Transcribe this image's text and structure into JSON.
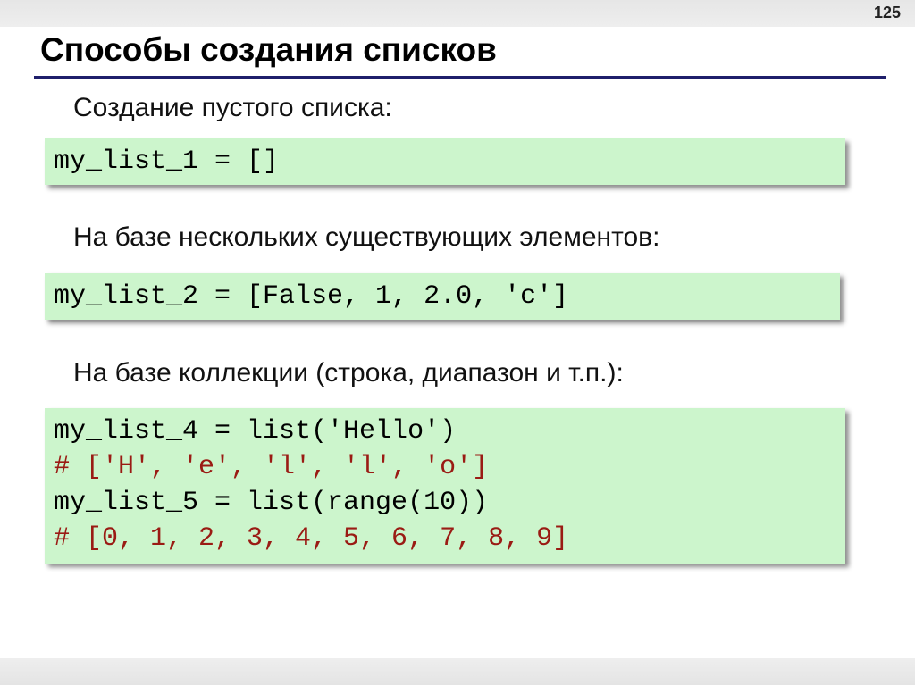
{
  "page_number": "125",
  "title": "Способы создания списков",
  "sections": [
    {
      "label": "Создание пустого списка:",
      "code": [
        {
          "text": "my_list_1 = []",
          "type": "code"
        }
      ]
    },
    {
      "label": "На базе нескольких существующих элементов:",
      "code": [
        {
          "text": "my_list_2 = [False, 1, 2.0, 'c']",
          "type": "code"
        }
      ]
    },
    {
      "label": "На базе коллекции (строка, диапазон и т.п.):",
      "code": [
        {
          "text": "my_list_4 = list('Hello')",
          "type": "code"
        },
        {
          "text": "# ['H', 'e', 'l', 'l', 'o']",
          "type": "comment"
        },
        {
          "text": "my_list_5 = list(range(10))",
          "type": "code"
        },
        {
          "text": "# [0, 1, 2, 3, 4, 5, 6, 7, 8, 9]",
          "type": "comment"
        }
      ]
    }
  ],
  "colors": {
    "title_rule": "#1f1f6b",
    "code_background": "#ccf5cc",
    "comment_text": "#9a1b14",
    "code_text": "#000000"
  }
}
